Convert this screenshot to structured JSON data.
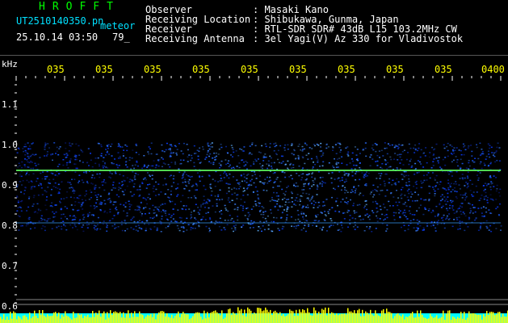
{
  "header": {
    "brand": "HROFFT",
    "file_name": "UT2510140350.pn",
    "file_type": "meteor",
    "date_time": "25.10.14 03:50",
    "count": "79_"
  },
  "metadata": [
    {
      "key": "Observer",
      "value": ": Masaki Kano"
    },
    {
      "key": "Receiving Location",
      "value": ": Shibukawa, Gunma, Japan"
    },
    {
      "key": "Receiver",
      "value": ": RTL-SDR SDR# 43dB L15 103.2MHz CW"
    },
    {
      "key": "Receiving Antenna",
      "value": ": 3el Yagi(V) Az 330 for Vladivostok"
    }
  ],
  "spectrogram": {
    "y_unit": "kHz",
    "y_ticks": [
      "1.1",
      "1.0",
      "0.9",
      "0.8",
      "0.7",
      "0.6"
    ],
    "time_ticks": [
      "035",
      "035",
      "035",
      "035",
      "035",
      "035",
      "035",
      "035",
      "035",
      "0400"
    ],
    "colors": {
      "text_cyan": "#00e0ff",
      "text_green": "#00ff00",
      "tick_yellow": "#ffff00",
      "noise_blue": "#0a3cff",
      "carrier": "#60ff60",
      "baseline_cyan": "#00ffff",
      "baseline_yellow": "#ffff00"
    }
  }
}
